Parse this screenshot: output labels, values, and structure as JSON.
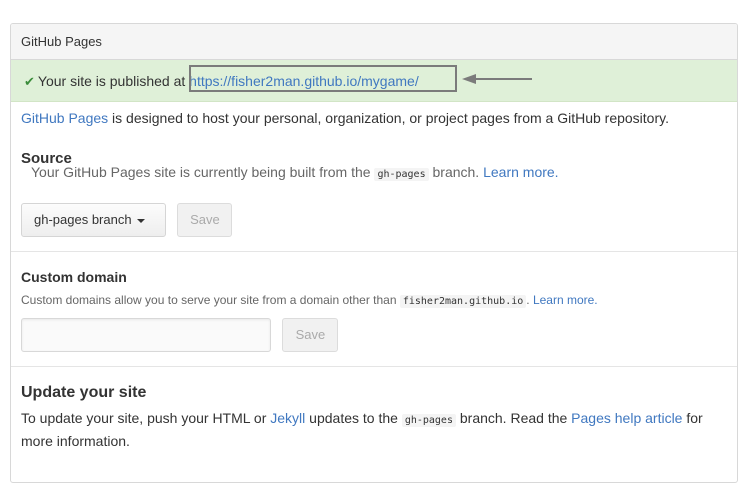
{
  "header": {
    "title": "GitHub Pages"
  },
  "flash": {
    "text": "Your site is published at",
    "url": "https://fisher2man.github.io/mygame/"
  },
  "intro": {
    "link": "GitHub Pages",
    "text": " is designed to host your personal, organization, or project pages from a GitHub repository."
  },
  "source": {
    "title": "Source",
    "desc_before": "Your GitHub Pages site is currently being built from the ",
    "code": "gh-pages",
    "desc_after": " branch. ",
    "learn_more": "Learn more.",
    "branch_button": "gh-pages branch",
    "save_button": "Save"
  },
  "custom_domain": {
    "title": "Custom domain",
    "desc_before": "Custom domains allow you to serve your site from a domain other than ",
    "code": "fisher2man.github.io",
    "desc_after": ". ",
    "learn_more": "Learn more.",
    "input_value": "",
    "save_button": "Save"
  },
  "update": {
    "title": "Update your site",
    "t1": "To update your site, push your HTML or ",
    "jekyll": "Jekyll",
    "t2": " updates to the ",
    "code": "gh-pages",
    "t3": " branch. Read the ",
    "help_link": "Pages help article",
    "t4": " for more information."
  },
  "colors": {
    "flash_bg": "#dff0d8",
    "link": "#4078c0",
    "check": "#3b8c3b",
    "annotation": "#7b7b7b"
  },
  "icons": {
    "check": "check-icon",
    "arrow": "arrow-left-icon",
    "caret": "caret-down-icon"
  }
}
